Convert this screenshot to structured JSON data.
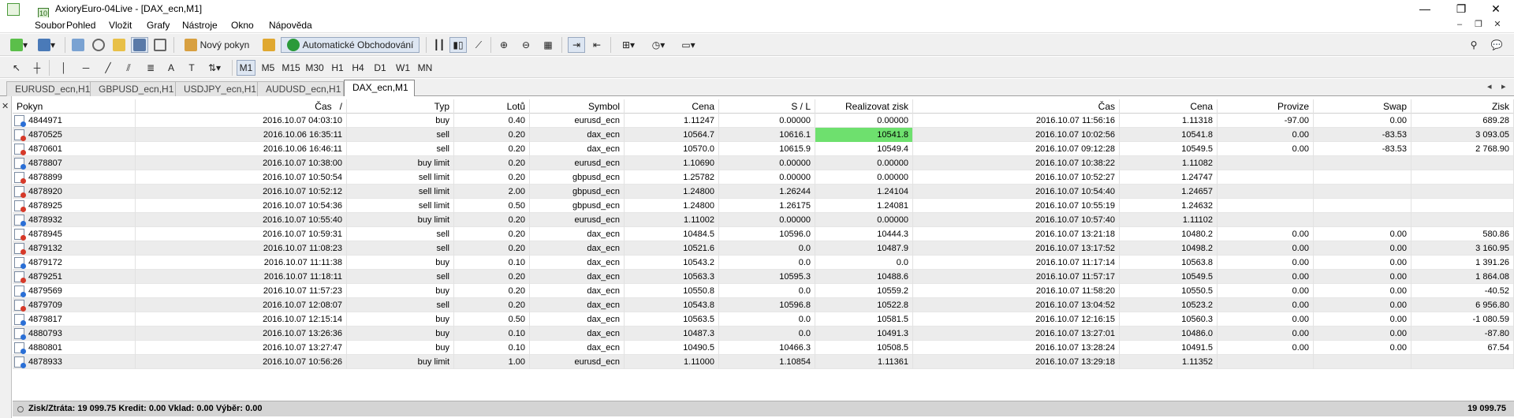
{
  "window": {
    "title": "AxioryEuro-04Live - [DAX_ecn,M1]",
    "app_icon_glyph": "10"
  },
  "menu": [
    "Soubor",
    "Pohled",
    "Vložit",
    "Grafy",
    "Nástroje",
    "Okno",
    "Nápověda"
  ],
  "toolbar": {
    "new_order_label": "Nový pokyn",
    "auto_trading_label": "Automatické Obchodování"
  },
  "timeframes": [
    "M1",
    "M5",
    "M15",
    "M30",
    "H1",
    "H4",
    "D1",
    "W1",
    "MN"
  ],
  "tabs": [
    "EURUSD_ecn,H1",
    "GBPUSD_ecn,H1",
    "USDJPY_ecn,H1",
    "AUDUSD_ecn,H1",
    "DAX_ecn,M1"
  ],
  "table": {
    "headers": [
      "Pokyn",
      "Čas",
      "Typ",
      "Lotů",
      "Symbol",
      "Cena",
      "S / L",
      "Realizovat zisk",
      "Čas",
      "Cena",
      "Provize",
      "Swap",
      "Zisk"
    ],
    "sort_indicator": "/",
    "rows": [
      [
        "4844971",
        "2016.10.07 04:03:10",
        "buy",
        "0.40",
        "eurusd_ecn",
        "1.11247",
        "0.00000",
        "0.00000",
        "2016.10.07 11:56:16",
        "1.11318",
        "-97.00",
        "0.00",
        "689.28"
      ],
      [
        "4870525",
        "2016.10.06 16:35:11",
        "sell",
        "0.20",
        "dax_ecn",
        "10564.7",
        "10616.1",
        "10541.8",
        "2016.10.07 10:02:56",
        "10541.8",
        "0.00",
        "-83.53",
        "3 093.05"
      ],
      [
        "4870601",
        "2016.10.06 16:46:11",
        "sell",
        "0.20",
        "dax_ecn",
        "10570.0",
        "10615.9",
        "10549.4",
        "2016.10.07 09:12:28",
        "10549.5",
        "0.00",
        "-83.53",
        "2 768.90"
      ],
      [
        "4878807",
        "2016.10.07 10:38:00",
        "buy limit",
        "0.20",
        "eurusd_ecn",
        "1.10690",
        "0.00000",
        "0.00000",
        "2016.10.07 10:38:22",
        "1.11082",
        "",
        "",
        ""
      ],
      [
        "4878899",
        "2016.10.07 10:50:54",
        "sell limit",
        "0.20",
        "gbpusd_ecn",
        "1.25782",
        "0.00000",
        "0.00000",
        "2016.10.07 10:52:27",
        "1.24747",
        "",
        "",
        ""
      ],
      [
        "4878920",
        "2016.10.07 10:52:12",
        "sell limit",
        "2.00",
        "gbpusd_ecn",
        "1.24800",
        "1.26244",
        "1.24104",
        "2016.10.07 10:54:40",
        "1.24657",
        "",
        "",
        ""
      ],
      [
        "4878925",
        "2016.10.07 10:54:36",
        "sell limit",
        "0.50",
        "gbpusd_ecn",
        "1.24800",
        "1.26175",
        "1.24081",
        "2016.10.07 10:55:19",
        "1.24632",
        "",
        "",
        ""
      ],
      [
        "4878932",
        "2016.10.07 10:55:40",
        "buy limit",
        "0.20",
        "eurusd_ecn",
        "1.11002",
        "0.00000",
        "0.00000",
        "2016.10.07 10:57:40",
        "1.11102",
        "",
        "",
        ""
      ],
      [
        "4878945",
        "2016.10.07 10:59:31",
        "sell",
        "0.20",
        "dax_ecn",
        "10484.5",
        "10596.0",
        "10444.3",
        "2016.10.07 13:21:18",
        "10480.2",
        "0.00",
        "0.00",
        "580.86"
      ],
      [
        "4879132",
        "2016.10.07 11:08:23",
        "sell",
        "0.20",
        "dax_ecn",
        "10521.6",
        "0.0",
        "10487.9",
        "2016.10.07 13:17:52",
        "10498.2",
        "0.00",
        "0.00",
        "3 160.95"
      ],
      [
        "4879172",
        "2016.10.07 11:11:38",
        "buy",
        "0.10",
        "dax_ecn",
        "10543.2",
        "0.0",
        "0.0",
        "2016.10.07 11:17:14",
        "10563.8",
        "0.00",
        "0.00",
        "1 391.26"
      ],
      [
        "4879251",
        "2016.10.07 11:18:11",
        "sell",
        "0.20",
        "dax_ecn",
        "10563.3",
        "10595.3",
        "10488.6",
        "2016.10.07 11:57:17",
        "10549.5",
        "0.00",
        "0.00",
        "1 864.08"
      ],
      [
        "4879569",
        "2016.10.07 11:57:23",
        "buy",
        "0.20",
        "dax_ecn",
        "10550.8",
        "0.0",
        "10559.2",
        "2016.10.07 11:58:20",
        "10550.5",
        "0.00",
        "0.00",
        "-40.52"
      ],
      [
        "4879709",
        "2016.10.07 12:08:07",
        "sell",
        "0.20",
        "dax_ecn",
        "10543.8",
        "10596.8",
        "10522.8",
        "2016.10.07 13:04:52",
        "10523.2",
        "0.00",
        "0.00",
        "6 956.80"
      ],
      [
        "4879817",
        "2016.10.07 12:15:14",
        "buy",
        "0.50",
        "dax_ecn",
        "10563.5",
        "0.0",
        "10581.5",
        "2016.10.07 12:16:15",
        "10560.3",
        "0.00",
        "0.00",
        "-1 080.59"
      ],
      [
        "4880793",
        "2016.10.07 13:26:36",
        "buy",
        "0.10",
        "dax_ecn",
        "10487.3",
        "0.0",
        "10491.3",
        "2016.10.07 13:27:01",
        "10486.0",
        "0.00",
        "0.00",
        "-87.80"
      ],
      [
        "4880801",
        "2016.10.07 13:27:47",
        "buy",
        "0.10",
        "dax_ecn",
        "10490.5",
        "10466.3",
        "10508.5",
        "2016.10.07 13:28:24",
        "10491.5",
        "0.00",
        "0.00",
        "67.54"
      ],
      [
        "4878933",
        "2016.10.07 10:56:26",
        "buy limit",
        "1.00",
        "eurusd_ecn",
        "1.11000",
        "1.10854",
        "1.11361",
        "2016.10.07 13:29:18",
        "1.11352",
        "",
        "",
        ""
      ]
    ],
    "highlight": {
      "row": 1,
      "col": 7,
      "color": "#6ee06e"
    },
    "icon_colors": {
      "buy": "#2a6fd6",
      "sell": "#d63a2a"
    }
  },
  "footer": {
    "summary": "Zisk/Ztráta: 19 099.75  Kredit: 0.00  Vklad: 0.00  Výběr: 0.00",
    "total": "19 099.75"
  }
}
